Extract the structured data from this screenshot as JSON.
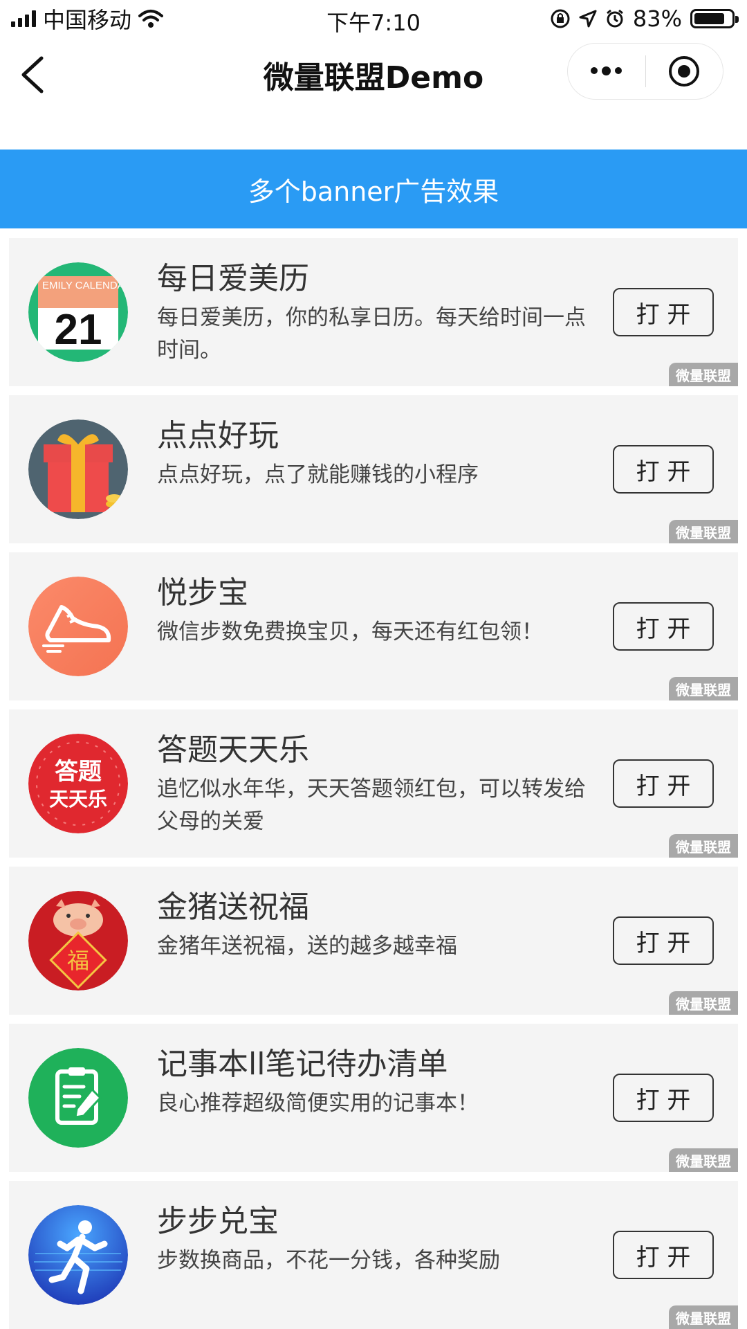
{
  "status_bar": {
    "carrier": "中国移动",
    "time": "下午7:10",
    "battery": "83%",
    "battery_level": 0.83
  },
  "nav": {
    "title": "微量联盟Demo",
    "back_icon": "chevron-left-icon",
    "more_icon": "more-dots-icon",
    "close_icon": "target-icon"
  },
  "banner": {
    "text": "多个banner广告效果",
    "color": "#2a9bf4"
  },
  "ads": [
    {
      "title": "每日爱美历",
      "desc": "每日爱美历，你的私享日历。每天给时间一点时间。",
      "button": "打 开",
      "badge": "微量联盟",
      "icon": "calendar-icon",
      "icon_text_top": "EMILY CALENDAR",
      "icon_text_num": "21"
    },
    {
      "title": "点点好玩",
      "desc": "点点好玩，点了就能赚钱的小程序",
      "button": "打 开",
      "badge": "微量联盟",
      "icon": "gift-box-icon"
    },
    {
      "title": "悦步宝",
      "desc": "微信步数免费换宝贝，每天还有红包领！",
      "button": "打 开",
      "badge": "微量联盟",
      "icon": "sneaker-icon"
    },
    {
      "title": "答题天天乐",
      "desc": "追忆似水年华，天天答题领红包，可以转发给父母的关爱",
      "button": "打 开",
      "badge": "微量联盟",
      "icon": "quiz-badge-icon",
      "icon_text_1": "答题",
      "icon_text_2": "天天乐"
    },
    {
      "title": "金猪送祝福",
      "desc": "金猪年送祝福，送的越多越幸福",
      "button": "打 开",
      "badge": "微量联盟",
      "icon": "pig-fortune-icon",
      "icon_text_1": "福"
    },
    {
      "title": "记事本ll笔记待办清单",
      "desc": "良心推荐超级简便实用的记事本！",
      "button": "打 开",
      "badge": "微量联盟",
      "icon": "clipboard-notes-icon"
    },
    {
      "title": "步步兑宝",
      "desc": "步数换商品，不花一分钱，各种奖励",
      "button": "打 开",
      "badge": "微量联盟",
      "icon": "runner-icon"
    }
  ]
}
